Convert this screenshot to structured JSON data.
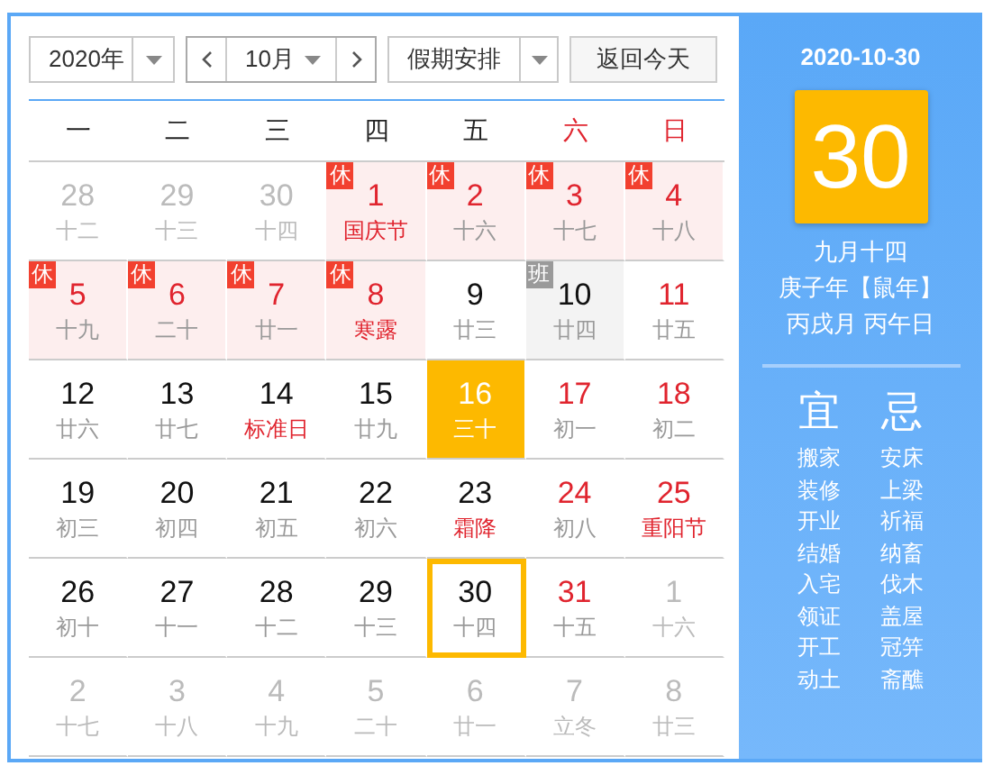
{
  "toolbar": {
    "year": "2020年",
    "month": "10月",
    "holiday_select": "假期安排",
    "today_button": "返回今天"
  },
  "weekdays": [
    {
      "label": "一",
      "weekend": false
    },
    {
      "label": "二",
      "weekend": false
    },
    {
      "label": "三",
      "weekend": false
    },
    {
      "label": "四",
      "weekend": false
    },
    {
      "label": "五",
      "weekend": false
    },
    {
      "label": "六",
      "weekend": true
    },
    {
      "label": "日",
      "weekend": true
    }
  ],
  "days": [
    {
      "day": "28",
      "lunar": "十二",
      "muted": true,
      "red": false,
      "festival": false,
      "today": false,
      "selected": false
    },
    {
      "day": "29",
      "lunar": "十三",
      "muted": true,
      "red": false,
      "festival": false,
      "today": false,
      "selected": false
    },
    {
      "day": "30",
      "lunar": "十四",
      "muted": true,
      "red": false,
      "festival": false,
      "today": false,
      "selected": false
    },
    {
      "day": "1",
      "lunar": "国庆节",
      "muted": false,
      "red": true,
      "festival": true,
      "today": false,
      "selected": false,
      "badge": {
        "text": "休",
        "kind": "rest"
      }
    },
    {
      "day": "2",
      "lunar": "十六",
      "muted": false,
      "red": true,
      "festival": false,
      "today": false,
      "selected": false,
      "badge": {
        "text": "休",
        "kind": "rest"
      }
    },
    {
      "day": "3",
      "lunar": "十七",
      "muted": false,
      "red": true,
      "festival": false,
      "today": false,
      "selected": false,
      "badge": {
        "text": "休",
        "kind": "rest"
      }
    },
    {
      "day": "4",
      "lunar": "十八",
      "muted": false,
      "red": true,
      "festival": false,
      "today": false,
      "selected": false,
      "badge": {
        "text": "休",
        "kind": "rest"
      }
    },
    {
      "day": "5",
      "lunar": "十九",
      "muted": false,
      "red": true,
      "festival": false,
      "today": false,
      "selected": false,
      "badge": {
        "text": "休",
        "kind": "rest"
      }
    },
    {
      "day": "6",
      "lunar": "二十",
      "muted": false,
      "red": true,
      "festival": false,
      "today": false,
      "selected": false,
      "badge": {
        "text": "休",
        "kind": "rest"
      }
    },
    {
      "day": "7",
      "lunar": "廿一",
      "muted": false,
      "red": true,
      "festival": false,
      "today": false,
      "selected": false,
      "badge": {
        "text": "休",
        "kind": "rest"
      }
    },
    {
      "day": "8",
      "lunar": "寒露",
      "muted": false,
      "red": true,
      "festival": true,
      "today": false,
      "selected": false,
      "badge": {
        "text": "休",
        "kind": "rest"
      }
    },
    {
      "day": "9",
      "lunar": "廿三",
      "muted": false,
      "red": false,
      "festival": false,
      "today": false,
      "selected": false
    },
    {
      "day": "10",
      "lunar": "廿四",
      "muted": false,
      "red": false,
      "festival": false,
      "today": false,
      "selected": false,
      "badge": {
        "text": "班",
        "kind": "work"
      }
    },
    {
      "day": "11",
      "lunar": "廿五",
      "muted": false,
      "red": true,
      "festival": false,
      "today": false,
      "selected": false
    },
    {
      "day": "12",
      "lunar": "廿六",
      "muted": false,
      "red": false,
      "festival": false,
      "today": false,
      "selected": false
    },
    {
      "day": "13",
      "lunar": "廿七",
      "muted": false,
      "red": false,
      "festival": false,
      "today": false,
      "selected": false
    },
    {
      "day": "14",
      "lunar": "标准日",
      "muted": false,
      "red": false,
      "festival": true,
      "today": false,
      "selected": false
    },
    {
      "day": "15",
      "lunar": "廿九",
      "muted": false,
      "red": false,
      "festival": false,
      "today": false,
      "selected": false
    },
    {
      "day": "16",
      "lunar": "三十",
      "muted": false,
      "red": false,
      "festival": false,
      "today": true,
      "selected": false
    },
    {
      "day": "17",
      "lunar": "初一",
      "muted": false,
      "red": true,
      "festival": false,
      "today": false,
      "selected": false
    },
    {
      "day": "18",
      "lunar": "初二",
      "muted": false,
      "red": true,
      "festival": false,
      "today": false,
      "selected": false
    },
    {
      "day": "19",
      "lunar": "初三",
      "muted": false,
      "red": false,
      "festival": false,
      "today": false,
      "selected": false
    },
    {
      "day": "20",
      "lunar": "初四",
      "muted": false,
      "red": false,
      "festival": false,
      "today": false,
      "selected": false
    },
    {
      "day": "21",
      "lunar": "初五",
      "muted": false,
      "red": false,
      "festival": false,
      "today": false,
      "selected": false
    },
    {
      "day": "22",
      "lunar": "初六",
      "muted": false,
      "red": false,
      "festival": false,
      "today": false,
      "selected": false
    },
    {
      "day": "23",
      "lunar": "霜降",
      "muted": false,
      "red": false,
      "festival": true,
      "today": false,
      "selected": false
    },
    {
      "day": "24",
      "lunar": "初八",
      "muted": false,
      "red": true,
      "festival": false,
      "today": false,
      "selected": false
    },
    {
      "day": "25",
      "lunar": "重阳节",
      "muted": false,
      "red": true,
      "festival": true,
      "today": false,
      "selected": false
    },
    {
      "day": "26",
      "lunar": "初十",
      "muted": false,
      "red": false,
      "festival": false,
      "today": false,
      "selected": false
    },
    {
      "day": "27",
      "lunar": "十一",
      "muted": false,
      "red": false,
      "festival": false,
      "today": false,
      "selected": false
    },
    {
      "day": "28",
      "lunar": "十二",
      "muted": false,
      "red": false,
      "festival": false,
      "today": false,
      "selected": false
    },
    {
      "day": "29",
      "lunar": "十三",
      "muted": false,
      "red": false,
      "festival": false,
      "today": false,
      "selected": false
    },
    {
      "day": "30",
      "lunar": "十四",
      "muted": false,
      "red": false,
      "festival": false,
      "today": false,
      "selected": true
    },
    {
      "day": "31",
      "lunar": "十五",
      "muted": false,
      "red": true,
      "festival": false,
      "today": false,
      "selected": false
    },
    {
      "day": "1",
      "lunar": "十六",
      "muted": true,
      "red": false,
      "festival": false,
      "today": false,
      "selected": false
    },
    {
      "day": "2",
      "lunar": "十七",
      "muted": true,
      "red": false,
      "festival": false,
      "today": false,
      "selected": false
    },
    {
      "day": "3",
      "lunar": "十八",
      "muted": true,
      "red": false,
      "festival": false,
      "today": false,
      "selected": false
    },
    {
      "day": "4",
      "lunar": "十九",
      "muted": true,
      "red": false,
      "festival": false,
      "today": false,
      "selected": false
    },
    {
      "day": "5",
      "lunar": "二十",
      "muted": true,
      "red": false,
      "festival": false,
      "today": false,
      "selected": false
    },
    {
      "day": "6",
      "lunar": "廿一",
      "muted": true,
      "red": false,
      "festival": false,
      "today": false,
      "selected": false
    },
    {
      "day": "7",
      "lunar": "立冬",
      "muted": true,
      "red": false,
      "festival": false,
      "today": false,
      "selected": false
    },
    {
      "day": "8",
      "lunar": "廿三",
      "muted": true,
      "red": false,
      "festival": false,
      "today": false,
      "selected": false
    }
  ],
  "detail": {
    "date": "2020-10-30",
    "day": "30",
    "lunar_date": "九月十四",
    "year_ganzhi": "庚子年【鼠年】",
    "month_day_ganzhi": "丙戌月 丙午日",
    "yi": {
      "title": "宜",
      "items": [
        "搬家",
        "装修",
        "开业",
        "结婚",
        "入宅",
        "领证",
        "开工",
        "动土"
      ]
    },
    "ji": {
      "title": "忌",
      "items": [
        "安床",
        "上梁",
        "祈福",
        "纳畜",
        "伐木",
        "盖屋",
        "冠笄",
        "斋醮"
      ]
    }
  }
}
